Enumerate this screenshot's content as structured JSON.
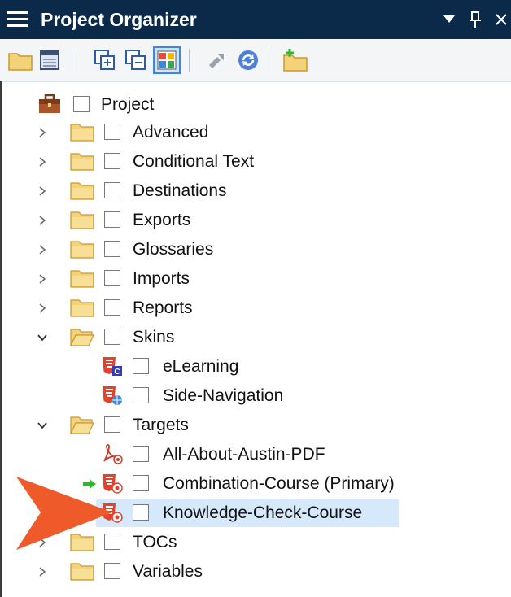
{
  "window": {
    "title": "Project Organizer",
    "titlebar_color": "#0b2a4a",
    "controls": {
      "dropdown_glyph": "▼",
      "pin_glyph": "📌",
      "close_glyph": "×"
    }
  },
  "toolbar": {
    "buttons": [
      {
        "icon": "open-folder-icon"
      },
      {
        "icon": "properties-icon"
      },
      {
        "icon": "expand-all-icon"
      },
      {
        "icon": "collapse-all-icon"
      },
      {
        "icon": "view-toggle-icon",
        "selected": true
      },
      {
        "icon": "build-icon"
      },
      {
        "icon": "refresh-icon"
      },
      {
        "icon": "new-folder-icon"
      }
    ]
  },
  "tree": {
    "root": {
      "label": "Project",
      "icon": "briefcase-icon"
    },
    "items": [
      {
        "label": "Advanced",
        "icon": "folder-icon",
        "expander": "collapsed"
      },
      {
        "label": "Conditional Text",
        "icon": "folder-icon",
        "expander": "collapsed"
      },
      {
        "label": "Destinations",
        "icon": "folder-icon",
        "expander": "collapsed"
      },
      {
        "label": "Exports",
        "icon": "folder-icon",
        "expander": "collapsed"
      },
      {
        "label": "Glossaries",
        "icon": "folder-icon",
        "expander": "collapsed"
      },
      {
        "label": "Imports",
        "icon": "folder-icon",
        "expander": "collapsed"
      },
      {
        "label": "Reports",
        "icon": "folder-icon",
        "expander": "collapsed"
      },
      {
        "label": "Skins",
        "icon": "open-folder-icon",
        "expander": "expanded"
      },
      {
        "label": "eLearning",
        "icon": "html5-skin-icon",
        "expander": "none"
      },
      {
        "label": "Side-Navigation",
        "icon": "html5-skin-globe-icon",
        "expander": "none"
      },
      {
        "label": "Targets",
        "icon": "open-folder-icon",
        "expander": "expanded"
      },
      {
        "label": "All-About-Austin-PDF",
        "icon": "pdf-target-icon",
        "expander": "none"
      },
      {
        "label": "Combination-Course (Primary)",
        "icon": "html5-target-icon",
        "expander": "none",
        "primary": true
      },
      {
        "label": "Knowledge-Check-Course",
        "icon": "html5-target-icon",
        "expander": "none",
        "selected": true
      },
      {
        "label": "TOCs",
        "icon": "folder-icon",
        "expander": "collapsed"
      },
      {
        "label": "Variables",
        "icon": "folder-icon",
        "expander": "collapsed"
      }
    ]
  },
  "colors": {
    "selection": "#d6e8fb",
    "folder": "#f4d27a",
    "target_red": "#e0442c",
    "callout_arrow": "#ee5a2a",
    "primary_arrow": "#2eb82e"
  }
}
